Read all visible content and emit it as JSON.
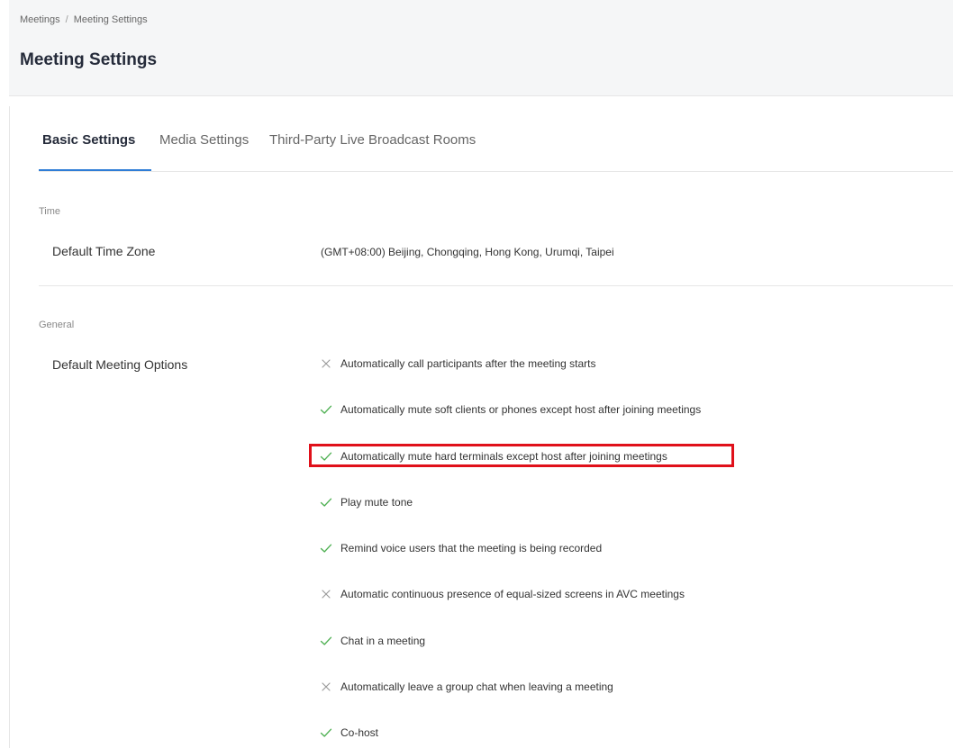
{
  "breadcrumb": {
    "items": [
      "Meetings",
      "Meeting Settings"
    ],
    "separator": "/"
  },
  "header": {
    "title": "Meeting Settings"
  },
  "tabs": [
    {
      "label": "Basic Settings",
      "active": true
    },
    {
      "label": "Media Settings",
      "active": false
    },
    {
      "label": "Third-Party Live Broadcast Rooms",
      "active": false
    }
  ],
  "sections": {
    "time": {
      "label": "Time",
      "default_time_zone_label": "Default Time Zone",
      "default_time_zone_value": "(GMT+08:00) Beijing, Chongqing, Hong Kong, Urumqi, Taipei"
    },
    "general": {
      "label": "General",
      "default_meeting_options_label": "Default Meeting Options",
      "options": [
        {
          "text": "Automatically call participants after the meeting starts",
          "enabled": false,
          "icon": "cross-icon"
        },
        {
          "text": "Automatically mute soft clients or phones except host after joining meetings",
          "enabled": true,
          "icon": "check-icon"
        },
        {
          "text": "Automatically mute hard terminals except host after joining meetings",
          "enabled": true,
          "icon": "check-icon",
          "highlighted": true
        },
        {
          "text": "Play mute tone",
          "enabled": true,
          "icon": "check-icon"
        },
        {
          "text": "Remind voice users that the meeting is being recorded",
          "enabled": true,
          "icon": "check-icon"
        },
        {
          "text": "Automatic continuous presence of equal-sized screens in AVC meetings",
          "enabled": false,
          "icon": "cross-icon"
        },
        {
          "text": "Chat in a meeting",
          "enabled": true,
          "icon": "check-icon"
        },
        {
          "text": "Automatically leave a group chat when leaving a meeting",
          "enabled": false,
          "icon": "cross-icon"
        },
        {
          "text": "Co-host",
          "enabled": true,
          "icon": "check-icon"
        }
      ]
    }
  },
  "colors": {
    "accent": "#2f7dd6",
    "check": "#4caf50",
    "cross": "#999999",
    "highlight": "#e0101a"
  }
}
